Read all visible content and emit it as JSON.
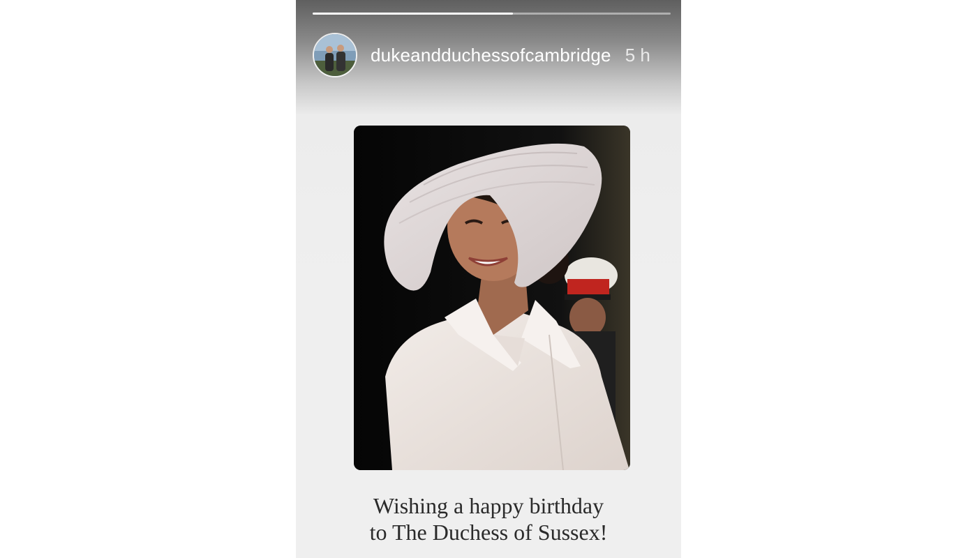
{
  "story": {
    "progress": 0.56,
    "author": {
      "username": "dukeandduchessofcambridge",
      "time_ago": "5 h",
      "avatar_icon": "profile-photo"
    },
    "image_icon": "portrait-photo-woman-white-hat",
    "caption_line1": "Wishing a happy birthday",
    "caption_line2": "to The Duchess of Sussex!"
  }
}
